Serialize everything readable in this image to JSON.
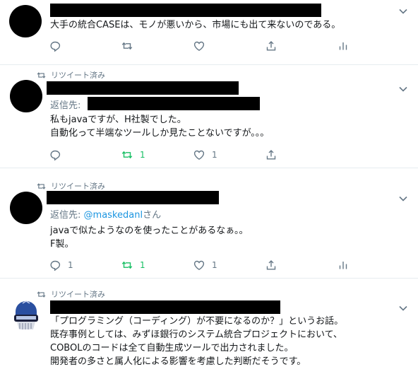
{
  "tweets": [
    {
      "text": "大手の統合CASEは、モノが悪いから、市場にも出て来ないのである。",
      "actions": {
        "reply": "",
        "retweet": "",
        "like": ""
      }
    },
    {
      "retweeted_label": "リツイート済み",
      "reply_label": "返信先:",
      "text": "私もjavaですが、H社製でした。\n自動化って半端なツールしか見たことないですが。。。",
      "actions": {
        "reply": "",
        "retweet": "1",
        "like": "1"
      }
    },
    {
      "retweeted_label": "リツイート済み",
      "reply_label": "返信先:",
      "reply_mention": "@maskedanl",
      "reply_suffix": "さん",
      "text": "javaで似たようなのを使ったことがあるなぁ。。\nF製。",
      "actions": {
        "reply": "1",
        "retweet": "1",
        "like": "1"
      }
    },
    {
      "retweeted_label": "リツイート済み",
      "text": "「プログラミング（コーディング）が不要になるのか？」というお話。\n既存事例としては、みずほ銀行のシステム統合プロジェクトにおいて、\nCOBOLのコードは全て自動生成ツールで出力されました。\n開発者の多さと属人化による影響を考慮した判断だそうです。"
    }
  ],
  "colors": {
    "text": "#14171a",
    "muted": "#657786",
    "link": "#1b95e0",
    "retweet_active": "#17bf63",
    "divider": "#e6ecf0"
  },
  "icons": [
    "reply-icon",
    "retweet-icon",
    "like-icon",
    "share-icon",
    "analytics-icon",
    "caret-down-icon"
  ]
}
